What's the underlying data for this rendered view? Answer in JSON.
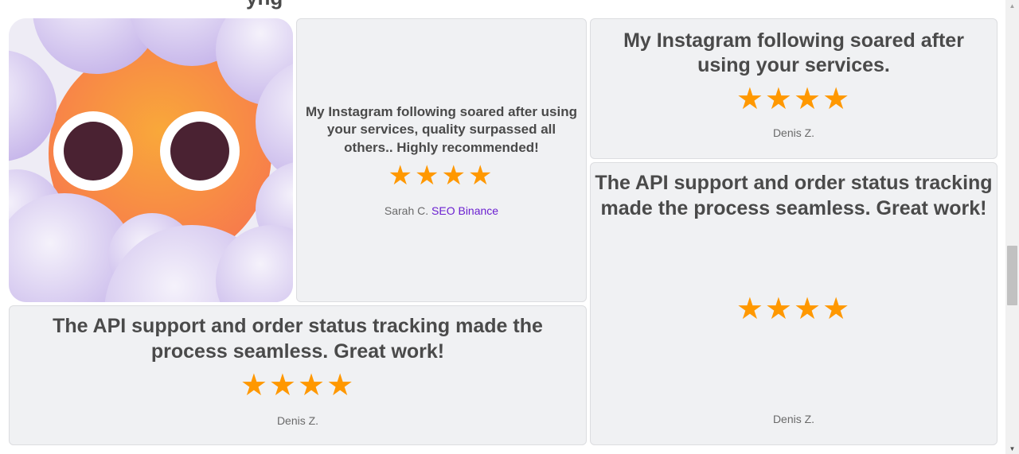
{
  "partial_heading": "yng",
  "image_tile": {
    "icon": "cute-sun-mascot-icon",
    "colors": {
      "sun": "#f7913d",
      "eye_white": "#ffffff",
      "pupil": "#4a2232",
      "cloud": "#d9cff0"
    }
  },
  "testimonials": [
    {
      "quote": "My Instagram following soared after using your services, quality surpassed all others.. Highly recommended!",
      "stars": [
        "★",
        "★",
        "★",
        "★"
      ],
      "author": "Sarah C.",
      "author_link": "SEO Binance"
    },
    {
      "quote": "My Instagram following soared after using your services.",
      "stars": [
        "★",
        "★",
        "★",
        "★"
      ],
      "author": "Denis Z."
    },
    {
      "quote": "The API support and order status tracking made the process seamless. Great work!",
      "stars": [
        "★",
        "★",
        "★",
        "★"
      ],
      "author": "Denis Z."
    },
    {
      "quote": "The API support and order status tracking made the process seamless. Great work!",
      "stars": [
        "★",
        "★",
        "★",
        "★"
      ],
      "author": "Denis Z."
    }
  ],
  "colors": {
    "star": "#ff9800",
    "card_bg": "#f0f1f3",
    "link": "#6a1fd0",
    "text": "#4a4a4a"
  },
  "scrollbar": {
    "up_arrow": "▲",
    "down_arrow": "▼"
  }
}
